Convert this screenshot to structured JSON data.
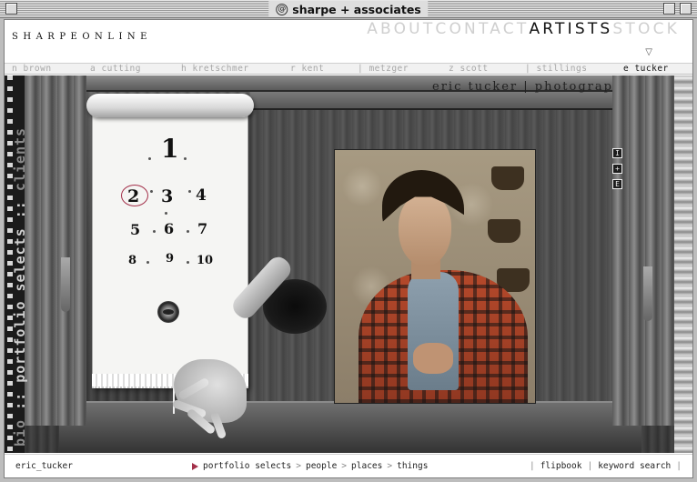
{
  "window": {
    "title": "sharpe + associates"
  },
  "header": {
    "logo": "SHARPEONLINE",
    "nav": [
      {
        "label": "ABOUT",
        "active": false
      },
      {
        "label": "CONTACT",
        "active": false
      },
      {
        "label": "ARTISTS",
        "active": true
      },
      {
        "label": "STOCK",
        "active": false
      }
    ]
  },
  "artists": [
    {
      "label": "n brown",
      "active": false
    },
    {
      "label": "a cutting",
      "active": false
    },
    {
      "label": "h kretschmer",
      "active": false
    },
    {
      "label": "r kent",
      "active": false
    },
    {
      "label": "| metzger",
      "active": false
    },
    {
      "label": "z scott",
      "active": false
    },
    {
      "label": "| stillings",
      "active": false
    },
    {
      "label": "e tucker",
      "active": true
    }
  ],
  "stage": {
    "photographer_label": "eric tucker | photographer",
    "side_text": {
      "bright": "portfolio selects",
      "dim": "clients",
      "extra": "bio"
    },
    "portfolio_numbers": [
      "1",
      "2",
      "3",
      "4",
      "5",
      "6",
      "7",
      "8",
      "9",
      "10"
    ],
    "selected_number": "2",
    "side_icons": [
      "I",
      "+",
      "E"
    ]
  },
  "footer": {
    "artist_id": "eric_tucker",
    "section": "portfolio selects",
    "categories": [
      "people",
      "places",
      "things"
    ],
    "right_links": [
      "flipbook",
      "keyword search"
    ],
    "separator": ">",
    "pipe": "|"
  }
}
